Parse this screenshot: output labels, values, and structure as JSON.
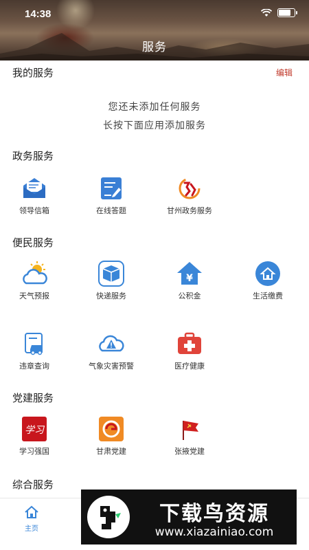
{
  "status_bar": {
    "time": "14:38"
  },
  "header": {
    "title": "服务"
  },
  "my_services": {
    "title": "我的服务",
    "edit_label": "编辑",
    "empty_line1": "您还未添加任何服务",
    "empty_line2": "长按下面应用添加服务"
  },
  "gov_services": {
    "title": "政务服务",
    "items": [
      {
        "label": "领导信箱",
        "icon": "mailbox-icon"
      },
      {
        "label": "在线答题",
        "icon": "quiz-edit-icon"
      },
      {
        "label": "甘州政务服务",
        "icon": "gov-seal-icon"
      }
    ]
  },
  "citizen_services": {
    "title": "便民服务",
    "items": [
      {
        "label": "天气预报",
        "icon": "weather-icon"
      },
      {
        "label": "快递服务",
        "icon": "package-icon"
      },
      {
        "label": "公积金",
        "icon": "housing-fund-icon"
      },
      {
        "label": "生活缴费",
        "icon": "utility-payment-icon"
      },
      {
        "label": "违章查询",
        "icon": "traffic-violation-icon"
      },
      {
        "label": "气象灾害预警",
        "icon": "weather-warning-icon"
      },
      {
        "label": "医疗健康",
        "icon": "medical-kit-icon"
      }
    ]
  },
  "party_services": {
    "title": "党建服务",
    "items": [
      {
        "label": "学习强国",
        "icon": "xuexi-qiangguo-icon",
        "icon_text": "学习"
      },
      {
        "label": "甘肃党建",
        "icon": "gansu-party-icon"
      },
      {
        "label": "张掖党建",
        "icon": "party-flag-icon"
      }
    ]
  },
  "general_services": {
    "title": "综合服务"
  },
  "bottom_nav": {
    "home_label": "主页"
  },
  "watermark": {
    "title": "下载鸟资源",
    "url": "www.xiazainiao.com"
  },
  "colors": {
    "accent_blue": "#3a86d8",
    "edit_red": "#c0392b",
    "party_red": "#c8161d",
    "orange": "#f08a24"
  }
}
